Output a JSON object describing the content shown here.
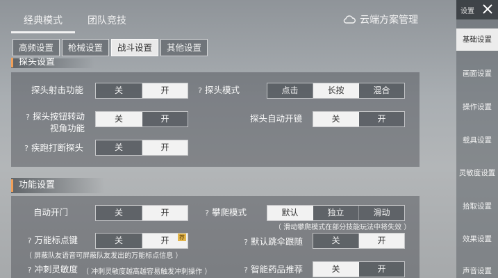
{
  "top_tabs": [
    {
      "label": "经典模式"
    },
    {
      "label": "团队竞技"
    }
  ],
  "cloud": {
    "label": "云端方案管理",
    "icon": "cloud-icon"
  },
  "sub_tabs": [
    {
      "label": "高频设置"
    },
    {
      "label": "枪械设置"
    },
    {
      "label": "战斗设置"
    },
    {
      "label": "其他设置"
    }
  ],
  "section1": {
    "title": "探头设置",
    "rows": {
      "peek_fire": {
        "label": "探头射击功能",
        "options": [
          "关",
          "开"
        ],
        "selected": "开"
      },
      "peek_mode": {
        "label": "探头模式",
        "options": [
          "点击",
          "长按",
          "混合"
        ],
        "selected": "长按"
      },
      "peek_button_rotate": {
        "label1": "探头按钮转动",
        "label2": "视角功能",
        "options": [
          "关",
          "开"
        ],
        "selected": "关"
      },
      "peek_auto_scope": {
        "label": "探头自动开镜",
        "options": [
          "关",
          "开"
        ],
        "selected": "关"
      },
      "sprint_interrupt": {
        "label": "疾跑打断探头",
        "options": [
          "关",
          "开"
        ],
        "selected": "开"
      }
    }
  },
  "section2": {
    "title": "功能设置",
    "rows": {
      "auto_door": {
        "label": "自动开门",
        "options": [
          "关",
          "开"
        ],
        "selected": "开"
      },
      "climb_mode": {
        "label": "攀爬模式",
        "options": [
          "默认",
          "独立",
          "滑动"
        ],
        "selected": "默认",
        "hint": "（ 滑动攀爬模式在部分技能玩法中将失效 ）"
      },
      "universal_mark": {
        "label": "万能标点键",
        "options": [
          "关",
          "开"
        ],
        "selected": "开",
        "badge": "荐",
        "hint": "（ 屏蔽队友语音可屏蔽队友发出的万能标点信息 ）"
      },
      "parachute_follow": {
        "label": "默认跳伞跟随",
        "options": [
          "关",
          "开"
        ],
        "selected": "开"
      },
      "sprint_sensitivity": {
        "label": "冲刺灵敏度",
        "hint": "（ 冲刺灵敏度越高越容易触发冲刺操作 ）"
      },
      "smart_medicine": {
        "label": "智能药品推荐",
        "options": [
          "关",
          "开"
        ],
        "selected": "关"
      }
    }
  },
  "sidebar": {
    "header": "设置",
    "close_icon": "close-icon",
    "items": [
      {
        "label": "基础设置"
      },
      {
        "label": "画面设置"
      },
      {
        "label": "操作设置"
      },
      {
        "label": "载具设置"
      },
      {
        "label": "灵敏度设置"
      },
      {
        "label": "拾取设置"
      },
      {
        "label": "效果设置"
      },
      {
        "label": "声音设置"
      }
    ]
  }
}
